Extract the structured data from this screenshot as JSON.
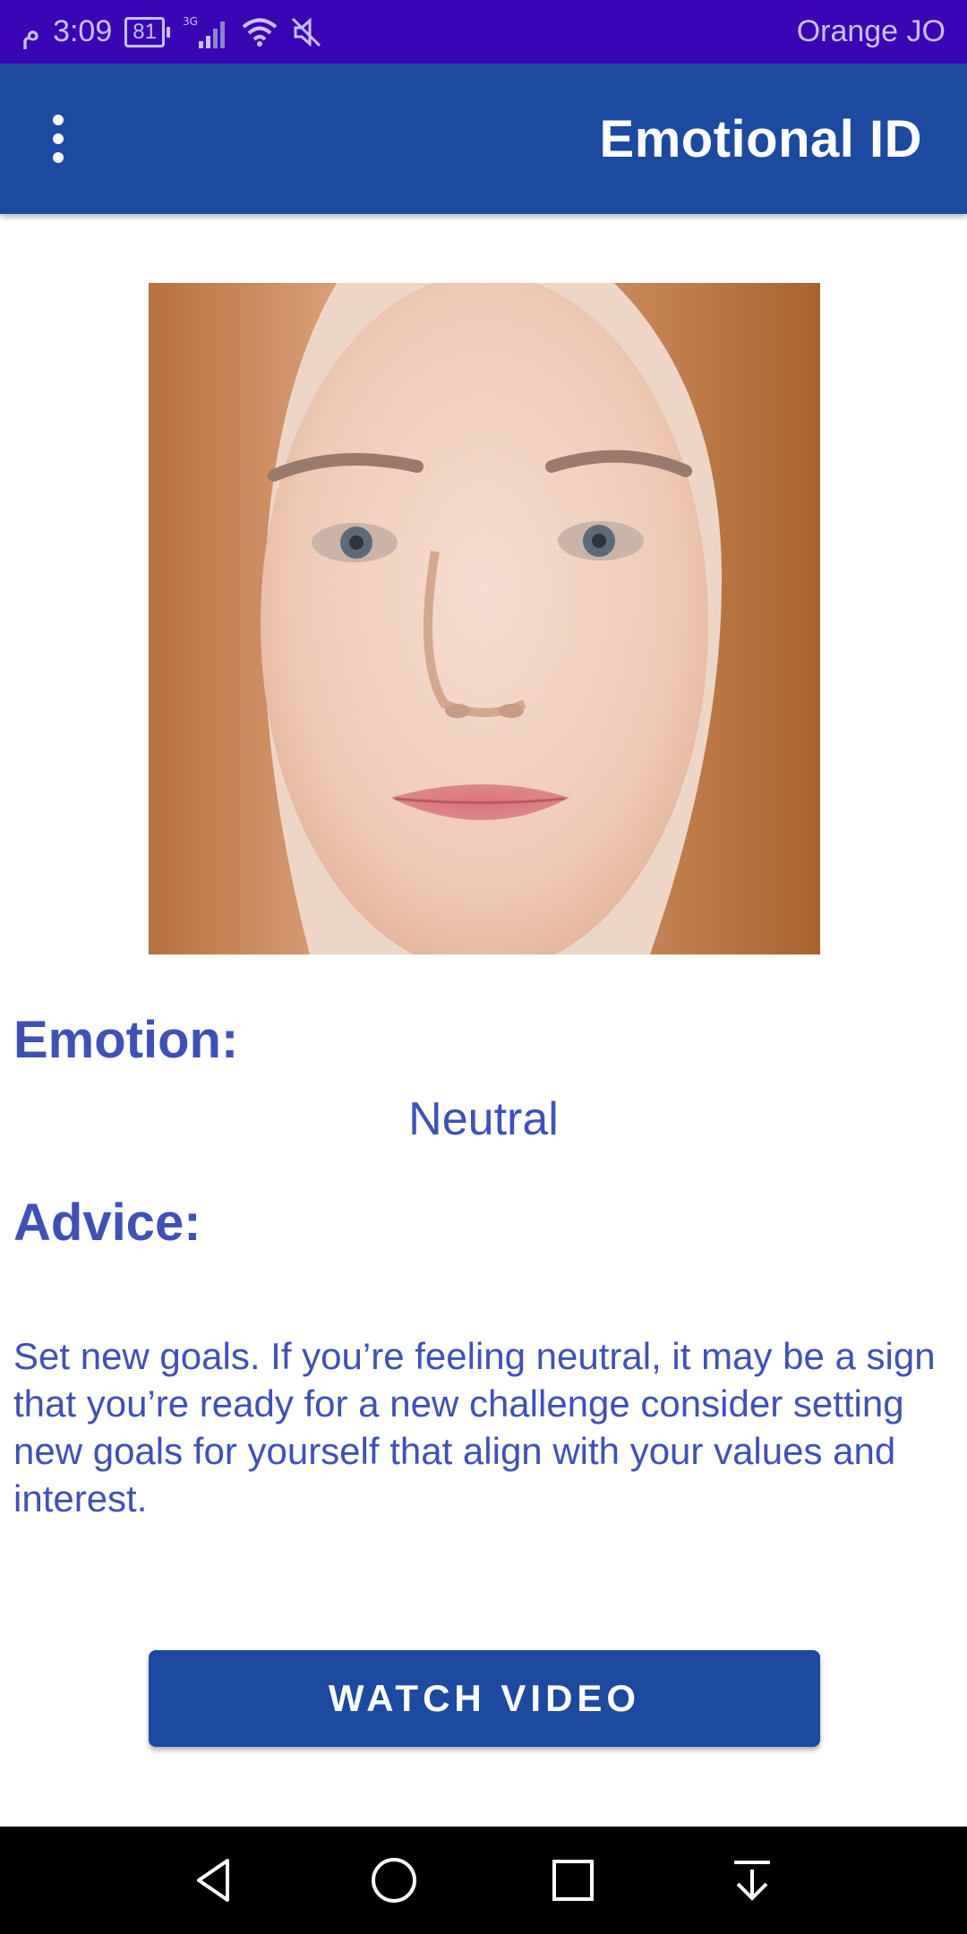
{
  "status_bar": {
    "time": "3:09",
    "am_pm": "م",
    "battery": "81",
    "network": "3G",
    "carrier": "Orange JO"
  },
  "app_bar": {
    "title": "Emotional ID",
    "menu_icon": "overflow-menu-icon"
  },
  "face_image": {
    "description_icon": "face-photo"
  },
  "emotion": {
    "heading": "Emotion:",
    "value": "Neutral"
  },
  "advice": {
    "heading": "Advice:",
    "text": "Set new goals. If you’re feeling neutral, it may be a sign that you’re ready for a new challenge consider setting new goals for yourself that align with your values and interest."
  },
  "actions": {
    "watch_video_label": "WATCH VIDEO"
  },
  "nav_bar": {
    "back_icon": "back-triangle-icon",
    "home_icon": "home-circle-icon",
    "recents_icon": "recents-square-icon",
    "notifications_icon": "pull-down-icon"
  },
  "colors": {
    "status_bar": "#3a05b5",
    "app_bar": "#1b4aa0",
    "accent_text": "#3f51b5",
    "nav_bar": "#000000"
  }
}
